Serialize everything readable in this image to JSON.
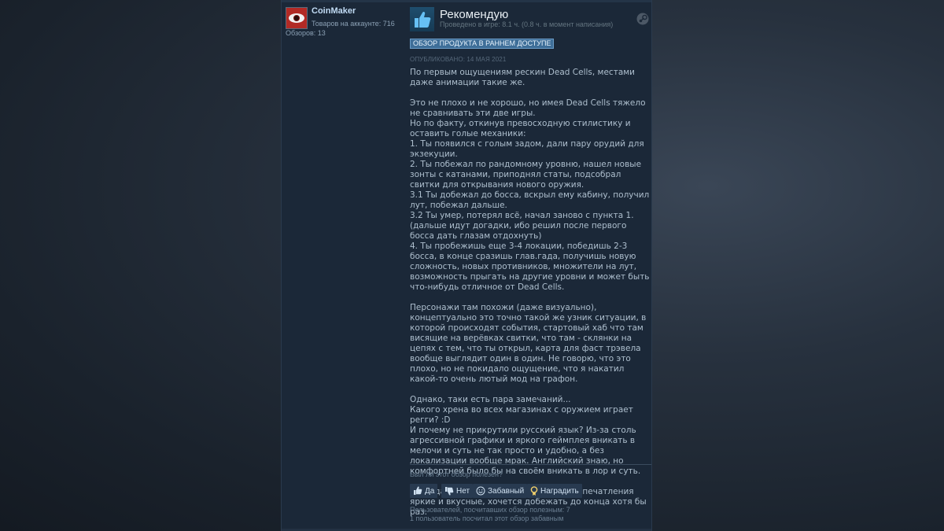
{
  "author": {
    "name": "CoinMaker",
    "products_on_account": "Товаров на аккаунте: 716",
    "reviews_count": "Обзоров: 13"
  },
  "review": {
    "verdict": "Рекомендую",
    "playtime": "Проведено в игре: 8.1 ч. (0.8 ч. в момент написания)",
    "early_access_badge": "ОБЗОР ПРОДУКТА В РАННЕМ ДОСТУПЕ",
    "published": "ОПУБЛИКОВАНО: 14 МАЯ 2021",
    "paragraphs": [
      "По первым ощущениям рескин Dead Cells, местами даже анимации такие же.",
      "",
      "Это не плохо и не хорошо, но имея Dead Cells тяжело не сравнивать эти две игры.",
      "Но по факту, откинув превосходную стилистику и оставить голые механики:",
      "1. Ты появился с голым задом, дали пару орудий для экзекуции.",
      "2. Ты побежал по рандомному уровню, нашел новые зонты с катанами, приподнял статы, подсобрал свитки для открывания нового оружия.",
      "3.1 Ты добежал до босса, вскрыл ему кабину, получил лут, побежал дальше.",
      "3.2 Ты умер, потерял всё, начал заново с пункта 1.",
      "(дальше идут догадки, ибо решил после первого босса дать глазам отдохнуть)",
      "4. Ты пробежишь еще 3-4 локации, победишь 2-3 босса, в конце сразишь глав.гада, получишь новую сложность, новых противников, множители на лут, возможность прыгать на другие уровни и может быть что-нибудь отличное от Dead Cells.",
      "",
      "Персонажи там похожи (даже визуально), концептуально это точно такой же узник ситуации, в которой происходят события, стартовый хаб что там висящие на верёвках свитки, что там - склянки на цепях с тем, что ты открыл, карта для фаст трэвела вообще выглядит один в один. Не говорю, что это плохо, но не покидало ощущение, что я накатил какой-то очень лютый мод на графон.",
      "",
      "Однако, таки есть пара замечаний...",
      "Какого хрена во всех магазинах с оружием играет регги? :D",
      "И почему не прикрутили русский язык? Из-за столь агрессивной графики и яркого геймплея вникать в мелочи и суть не так просто и удобно, а без локализации вообще мрак. Английский знаю, но комфортней было бы на своём вникать в лор и суть.",
      "",
      "Надо дать игре развиться, но первые впечатления яркие и вкусные, хочется добежать до конца хотя бы раз."
    ]
  },
  "feedback": {
    "question": "Был ли этот обзор полезен?",
    "yes_label": "Да",
    "no_label": "Нет",
    "funny_label": "Забавный",
    "award_label": "Наградить",
    "helpful_count": "Пользователей, посчитавших обзор полезным: 7",
    "funny_count": "1 пользователь посчитал этот обзор забавным"
  },
  "colors": {
    "panel_bg": "#1b2838",
    "badge_bg": "#3e6e98",
    "button_bg": "#283a50",
    "text_main": "#aebfce"
  },
  "icons": [
    "thumbs-up-icon",
    "thumbs-down-icon",
    "smiley-icon",
    "award-icon",
    "steam-icon"
  ]
}
